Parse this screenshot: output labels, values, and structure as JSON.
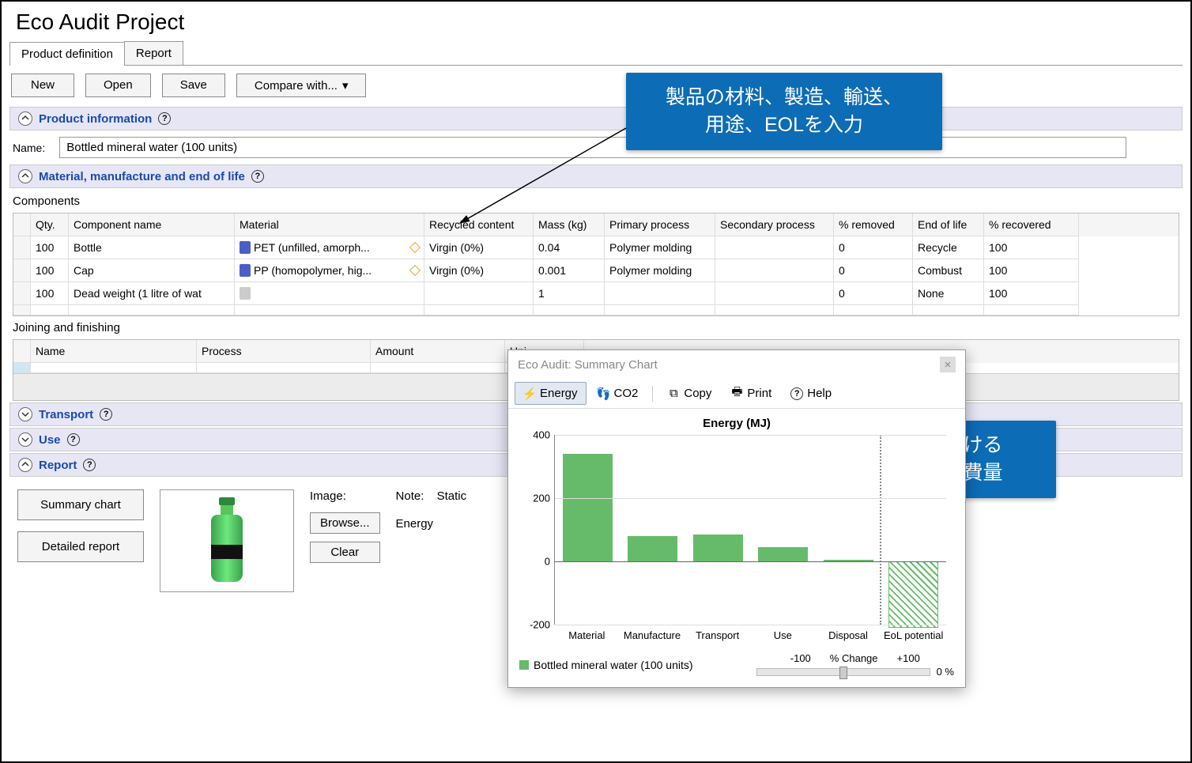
{
  "title": "Eco Audit Project",
  "tabs": {
    "product_definition": "Product definition",
    "report": "Report"
  },
  "toolbar": {
    "new": "New",
    "open": "Open",
    "save": "Save",
    "compare": "Compare with..."
  },
  "sections": {
    "product_info": "Product information",
    "material": "Material, manufacture and end of life",
    "transport": "Transport",
    "use": "Use",
    "report": "Report"
  },
  "name_label": "Name:",
  "name_value": "Bottled mineral water (100 units)",
  "components_label": "Components",
  "components_headers": {
    "qty": "Qty.",
    "name": "Component name",
    "material": "Material",
    "recycled": "Recycled content",
    "mass": "Mass (kg)",
    "primary": "Primary process",
    "secondary": "Secondary process",
    "removed": "% removed",
    "eol": "End of life",
    "recovered": "% recovered"
  },
  "components_rows": [
    {
      "qty": "100",
      "name": "Bottle",
      "material": "PET (unfilled, amorph...",
      "recycled": "Virgin (0%)",
      "mass": "0.04",
      "primary": "Polymer molding",
      "secondary": "",
      "removed": "0",
      "eol": "Recycle",
      "recovered": "100"
    },
    {
      "qty": "100",
      "name": "Cap",
      "material": "PP (homopolymer, hig...",
      "recycled": "Virgin (0%)",
      "mass": "0.001",
      "primary": "Polymer molding",
      "secondary": "",
      "removed": "0",
      "eol": "Combust",
      "recovered": "100"
    },
    {
      "qty": "100",
      "name": "Dead weight (1 litre of wat",
      "material": "",
      "recycled": "",
      "mass": "1",
      "primary": "",
      "secondary": "",
      "removed": "0",
      "eol": "None",
      "recovered": "100"
    }
  ],
  "joining_label": "Joining and finishing",
  "joining_headers": {
    "name": "Name",
    "process": "Process",
    "amount": "Amount",
    "unit": "Uni"
  },
  "report_panel": {
    "summary_chart": "Summary chart",
    "detailed_report": "Detailed report",
    "image_label": "Image:",
    "browse": "Browse...",
    "clear": "Clear",
    "note_label": "Note:",
    "note_line1": "Static",
    "note_line2": "Energy"
  },
  "callouts": {
    "c1_line1": "製品の材料、製造、輸送、",
    "c1_line2": "用途、EOLを入力",
    "c2_line1": "各工程における",
    "c2_line2": "エネルギ消費量"
  },
  "chart_window": {
    "title": "Eco Audit: Summary Chart",
    "tools": {
      "energy": "Energy",
      "co2": "CO2",
      "copy": "Copy",
      "print": "Print",
      "help": "Help"
    },
    "legend": "Bottled mineral water (100 units)",
    "slider": {
      "min": "-100",
      "label": "% Change",
      "max": "+100",
      "value": "0 %"
    }
  },
  "chart_data": {
    "type": "bar",
    "title": "Energy (MJ)",
    "ylabel": "",
    "ylim": [
      -200,
      400
    ],
    "yticks": [
      -200,
      0,
      200,
      400
    ],
    "categories": [
      "Material",
      "Manufacture",
      "Transport",
      "Use",
      "Disposal",
      "EoL potential"
    ],
    "values": [
      340,
      80,
      85,
      45,
      5,
      -210
    ],
    "series_name": "Bottled mineral water (100 units)",
    "eol_hatched": true
  }
}
